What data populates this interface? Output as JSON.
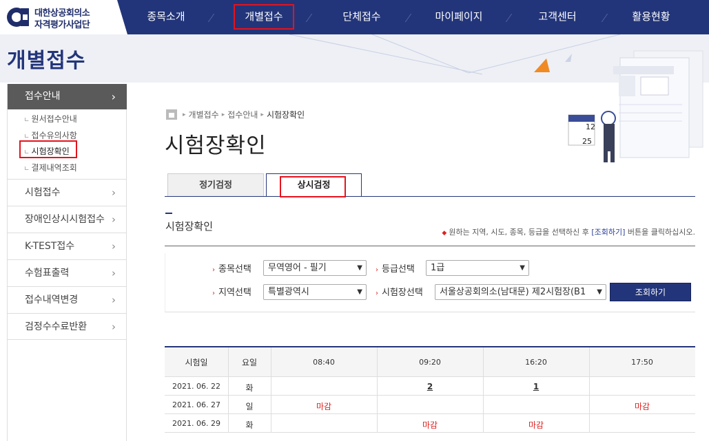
{
  "colors": {
    "brand_navy": "#23357a",
    "closed_red": "#d22222",
    "highlight_red": "#e5131c"
  },
  "logo": {
    "line1": "대한상공회의소",
    "line2": "자격평가사업단"
  },
  "nav": [
    "종목소개",
    "개별접수",
    "단체접수",
    "마이페이지",
    "고객센터",
    "활용현황"
  ],
  "banner": {
    "title": "개별접수"
  },
  "sidebar": {
    "active": "접수안내",
    "sub_items": [
      "원서접수안내",
      "접수유의사항",
      "시험장확인",
      "결제내역조회"
    ],
    "items": [
      "시험접수",
      "장애인상시시험접수",
      "K-TEST접수",
      "수험표출력",
      "접수내역변경",
      "검정수수료반환"
    ]
  },
  "breadcrumb": [
    "개별접수",
    "접수안내",
    "시험장확인"
  ],
  "page_title": "시험장확인",
  "tabs": [
    "정기검정",
    "상시검정"
  ],
  "section": {
    "title": "시험장확인",
    "note_pre": "원하는 지역, 시도, 종목, 등급을 선택하신 후 ",
    "note_link": "[조회하기]",
    "note_post": " 버튼을 클릭하십시오."
  },
  "filters": {
    "subject_label": "종목선택",
    "subject_value": "무역영어 - 필기",
    "grade_label": "등급선택",
    "grade_value": "1급",
    "region_label": "지역선택",
    "region_value": "특별광역시",
    "site_label": "시험장선택",
    "site_value": "서울상공회의소(남대문) 제2시험장(B1",
    "search_button": "조회하기"
  },
  "table": {
    "headers": [
      "시험일",
      "요일",
      "08:40",
      "09:20",
      "16:20",
      "17:50"
    ],
    "rows": [
      [
        "2021. 06. 22",
        "화",
        "",
        "2",
        "1",
        ""
      ],
      [
        "2021. 06. 27",
        "일",
        "마감",
        "",
        "",
        "마감"
      ],
      [
        "2021. 06. 29",
        "화",
        "",
        "마감",
        "마감",
        ""
      ]
    ]
  }
}
